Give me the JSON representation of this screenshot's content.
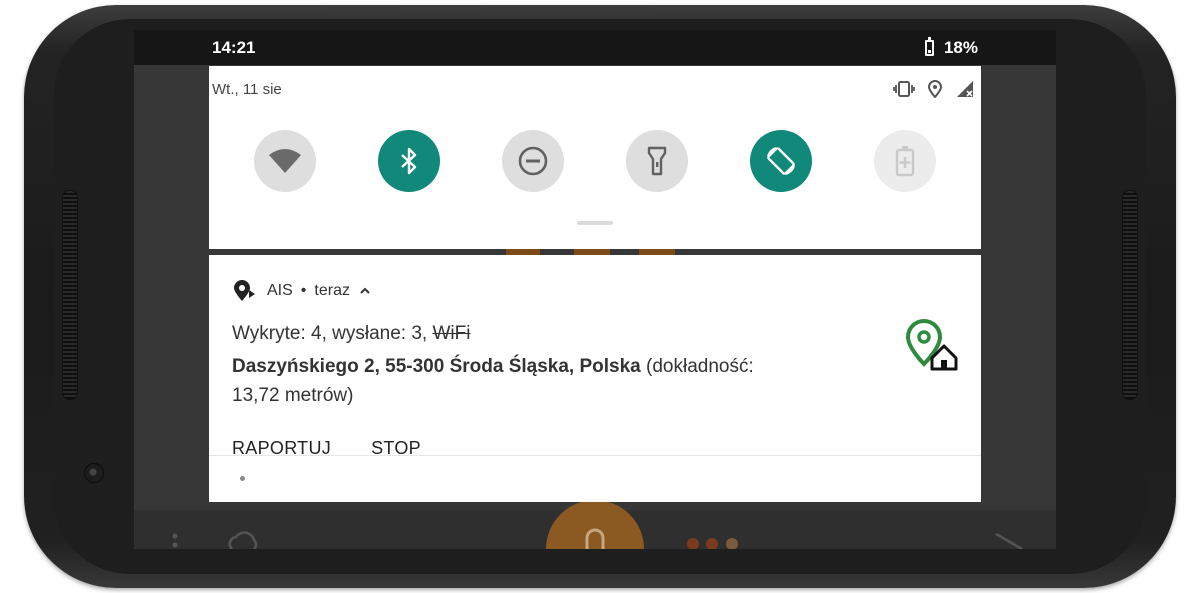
{
  "status_bar": {
    "time": "14:21",
    "battery_percent": "18%"
  },
  "quick_settings": {
    "date": "Wt., 11 sie",
    "status_icons": [
      "vibrate-icon",
      "location-icon",
      "signal-no-service-icon"
    ],
    "tiles": [
      {
        "name": "wifi",
        "icon": "wifi-icon",
        "state": "off"
      },
      {
        "name": "bluetooth",
        "icon": "bluetooth-icon",
        "state": "on"
      },
      {
        "name": "do-not-disturb",
        "icon": "do-not-disturb-icon",
        "state": "off"
      },
      {
        "name": "flashlight",
        "icon": "flashlight-icon",
        "state": "off"
      },
      {
        "name": "auto-rotate",
        "icon": "auto-rotate-icon",
        "state": "on"
      },
      {
        "name": "battery-saver",
        "icon": "battery-saver-icon",
        "state": "disabled"
      }
    ]
  },
  "notification": {
    "app_name": "AIS",
    "separator": "•",
    "time": "teraz",
    "line1_prefix": "Wykryte: 4, wysłane: 3, ",
    "line1_struck": "WiFi",
    "address": "Daszyńskiego 2, 55-300 Środa Śląska, Polska",
    "accuracy": " (dokładność: 13,72 metrów)",
    "actions": {
      "report": "RAPORTUJ",
      "stop": "STOP"
    }
  },
  "colors": {
    "accent_teal": "#11897a",
    "ais_green": "#2e8b3e",
    "phone_body": "#1e1e1e"
  }
}
